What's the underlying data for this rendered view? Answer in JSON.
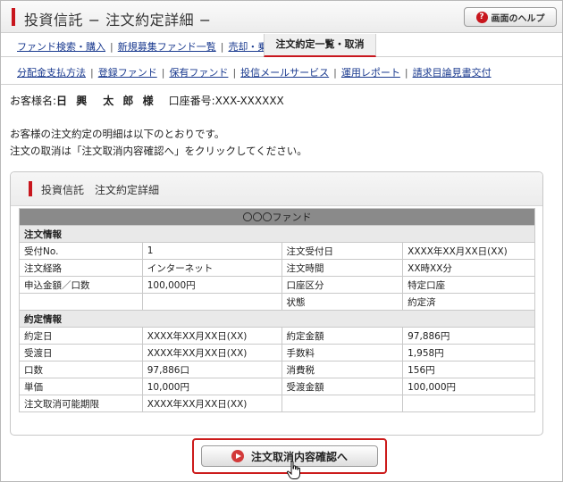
{
  "header": {
    "title": "投資信託 − 注文約定詳細 −",
    "help_label": "画面のヘルプ"
  },
  "nav_primary": {
    "items": [
      "ファンド検索・購入",
      "新規募集ファンド一覧",
      "売却・乗換"
    ],
    "active": "注文約定一覧・取消"
  },
  "nav_secondary": {
    "items": [
      "分配金支払方法",
      "登録ファンド",
      "保有ファンド",
      "投信メールサービス",
      "運用レポート",
      "請求目論見書交付"
    ]
  },
  "customer": {
    "label": "お客様名:",
    "name": "日 興　太 郎 様",
    "account_label": "口座番号:",
    "account_number": "XXX-XXXXXX"
  },
  "intro": {
    "line1": "お客様の注文約定の明細は以下のとおりです。",
    "line2": "注文の取消は「注文取消内容確認へ」をクリックしてください。"
  },
  "panel": {
    "title": "投資信託　注文約定詳細",
    "fund_name": "〇〇〇ファンド",
    "order_section": "注文情報",
    "order_rows": [
      [
        "受付No.",
        "1",
        "注文受付日",
        "XXXX年XX月XX日(XX)"
      ],
      [
        "注文経路",
        "インターネット",
        "注文時間",
        "XX時XX分"
      ],
      [
        "申込金額／口数",
        "100,000円",
        "口座区分",
        "特定口座"
      ],
      [
        "",
        "",
        "状態",
        "約定済"
      ]
    ],
    "contract_section": "約定情報",
    "contract_rows": [
      [
        "約定日",
        "XXXX年XX月XX日(XX)",
        "約定金額",
        "97,886円"
      ],
      [
        "受渡日",
        "XXXX年XX月XX日(XX)",
        "手数料",
        "1,958円"
      ],
      [
        "口数",
        "97,886口",
        "消費税",
        "156円"
      ],
      [
        "単価",
        "10,000円",
        "受渡金額",
        "100,000円"
      ],
      [
        "注文取消可能期限",
        "XXXX年XX月XX日(XX)",
        "",
        ""
      ]
    ]
  },
  "action": {
    "label": "注文取消内容確認へ"
  },
  "colors": {
    "accent": "#c8161d",
    "link": "#1a3a8f"
  },
  "icons": {
    "help": "question-circle-icon",
    "play": "play-circle-icon",
    "cursor": "hand-pointer-icon"
  }
}
